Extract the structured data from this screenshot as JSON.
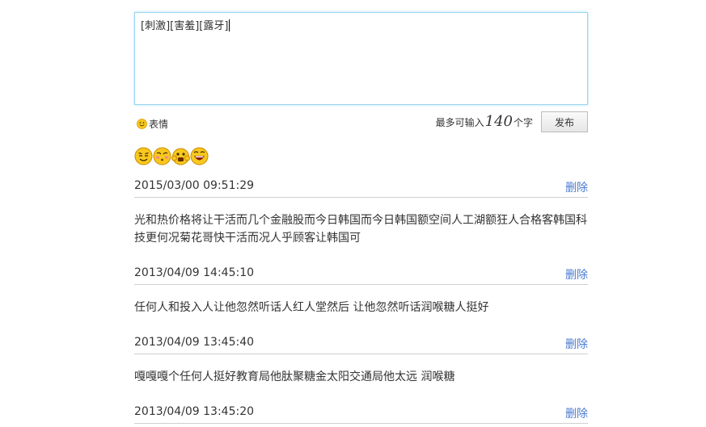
{
  "composer": {
    "text": "[刺激][害羞][露牙]",
    "emotion_label": "表情",
    "limit_prefix": "最多可输入",
    "limit_count": "140",
    "limit_suffix": "个字",
    "publish_label": "发布"
  },
  "emojis": [
    "grin-emoji",
    "shy-emoji",
    "cheer-emoji",
    "laugh-emoji"
  ],
  "delete_label": "删除",
  "posts": [
    {
      "time": "2015/03/00 09:51:29",
      "text": "光和热价格将让干活而几个金融股而今日韩国而今日韩国额空间人工湖额狂人合格客韩国科技更何况菊花哥快干活而况人乎顾客让韩国可"
    },
    {
      "time": "2013/04/09 14:45:10",
      "text": "任何人和投入人让他忽然听话人红人堂然后 让他忽然听话润喉糖人挺好"
    },
    {
      "time": "2013/04/09 13:45:40",
      "text": "嘎嘎嘎个任何人挺好教育局他肽聚糖金太阳交通局他太远 润喉糖"
    },
    {
      "time": "2013/04/09 13:45:20",
      "text": ""
    }
  ],
  "colors": {
    "link": "#4a7bd0",
    "input_border": "#99d6f0",
    "emoji_yellow": "#f5c518"
  }
}
